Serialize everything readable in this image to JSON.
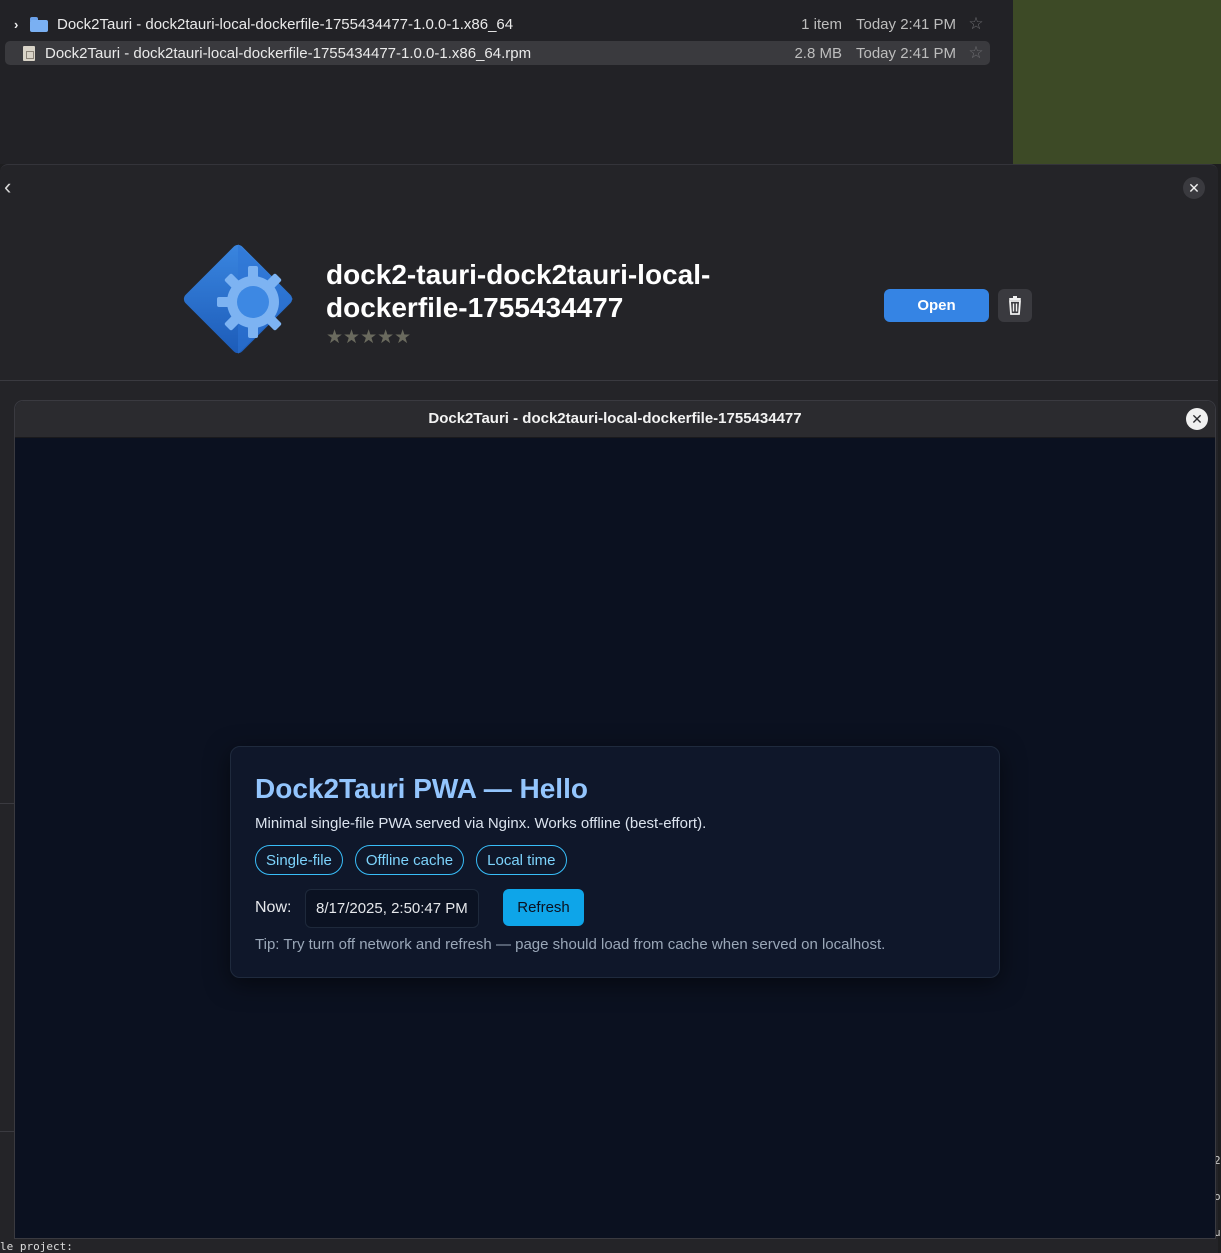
{
  "file_manager": {
    "rows": [
      {
        "name": "Dock2Tauri - dock2tauri-local-dockerfile-1755434477-1.0.0-1.x86_64",
        "size": "1 item",
        "date": "Today 2:41 PM",
        "type_icon": "folder-icon",
        "expander": "›"
      },
      {
        "name": "Dock2Tauri - dock2tauri-local-dockerfile-1755434477-1.0.0-1.x86_64.rpm",
        "size": "2.8 MB",
        "date": "Today 2:41 PM",
        "type_icon": "rpm-file-icon"
      }
    ],
    "star_glyph": "☆"
  },
  "software_center": {
    "back_glyph": "‹",
    "close_glyph": "✕",
    "app_name": "dock2-tauri-dock2tauri-local-dockerfile-1755434477",
    "rating_glyphs": "★★★★★",
    "open_label": "Open",
    "accent_color": "#3584e4"
  },
  "app_window": {
    "title": "Dock2Tauri - dock2tauri-local-dockerfile-1755434477",
    "close_glyph": "✕",
    "card": {
      "heading": "Dock2Tauri PWA — Hello",
      "description": "Minimal single-file PWA served via Nginx. Works offline (best-effort).",
      "chips": [
        "Single-file",
        "Offline cache",
        "Local time"
      ],
      "now_label": "Now:",
      "now_value": "8/17/2025, 2:50:47 PM",
      "refresh_label": "Refresh",
      "tip": "Tip: Try turn off network and refresh — page should load from cache when served on localhost."
    }
  },
  "background_text": {
    "terminal_fragment": "le project:",
    "edge_chars": [
      "2",
      "o",
      "u"
    ]
  }
}
